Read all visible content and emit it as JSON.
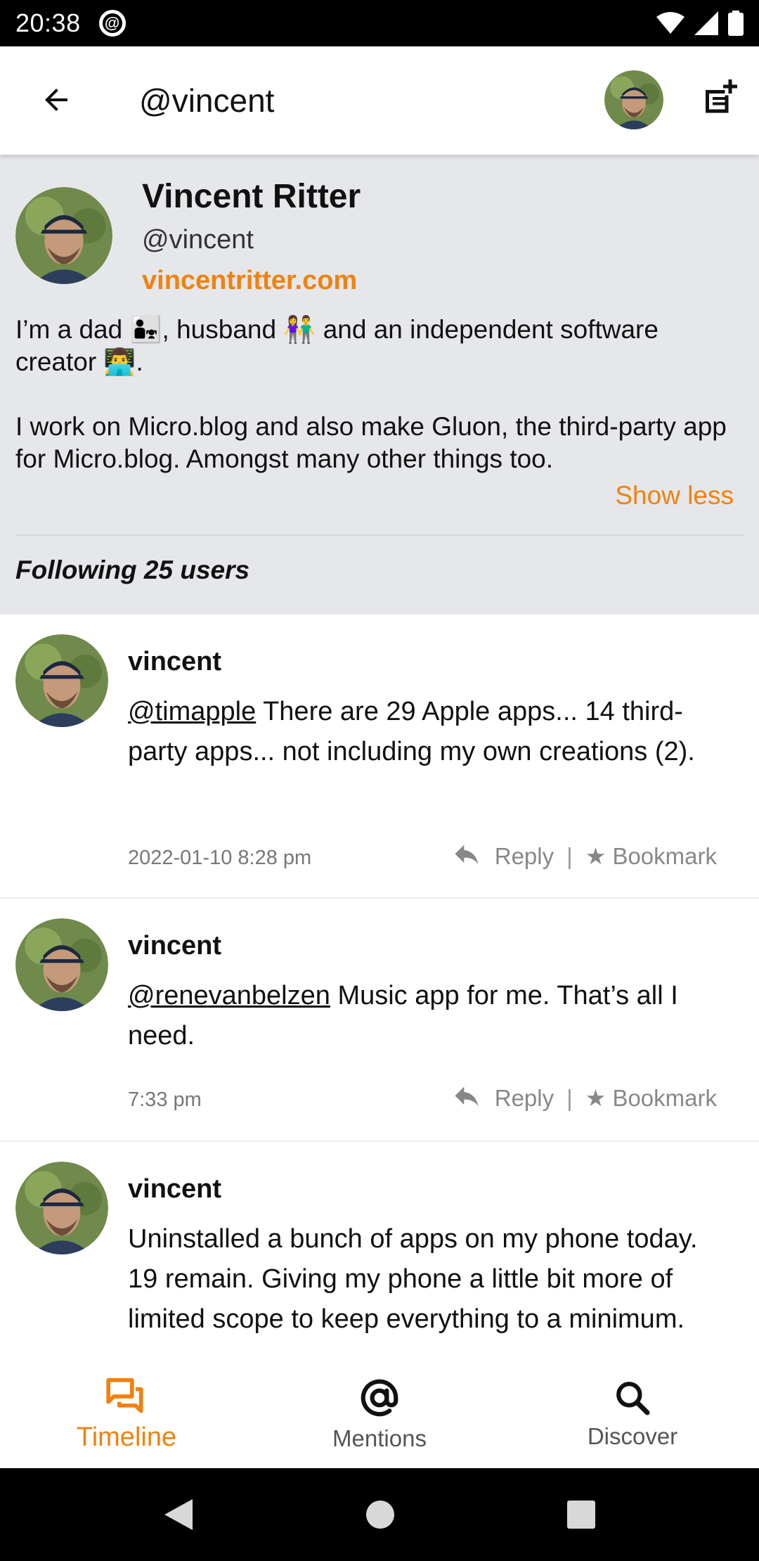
{
  "status_bar": {
    "time": "20:38",
    "at_icon": "@"
  },
  "header": {
    "title": "@vincent"
  },
  "profile": {
    "name": "Vincent Ritter",
    "handle": "@vincent",
    "website": "vincentritter.com",
    "bio_line1": "I’m a dad 👨‍👧, husband 👫 and an independent software creator 👨‍💻.",
    "bio_line2": "I work on Micro.blog and also make Gluon, the third-party app for Micro.blog. Amongst many other things too.",
    "show_less": "Show less",
    "following": "Following 25 users"
  },
  "posts": [
    {
      "author": "vincent",
      "mention": "@timapple",
      "text": " There are 29 Apple apps... 14 third-party apps... not including my own creations (2).",
      "time": "2022-01-10 8:28 pm"
    },
    {
      "author": "vincent",
      "mention": "@renevanbelzen",
      "text": " Music app for me. That’s all I need.",
      "time": "7:33 pm"
    },
    {
      "author": "vincent",
      "mention": "",
      "text": "Uninstalled a bunch of apps on my phone today. 19 remain. Giving my phone a little bit more of limited scope to keep everything to a minimum.",
      "time": ""
    }
  ],
  "actions": {
    "reply": "Reply",
    "separator": "|",
    "bookmark": "★ Bookmark"
  },
  "nav": {
    "timeline": "Timeline",
    "mentions": "Mentions",
    "discover": "Discover"
  },
  "colors": {
    "accent": "#f0820f",
    "profile_bg": "#e6e7ea"
  }
}
